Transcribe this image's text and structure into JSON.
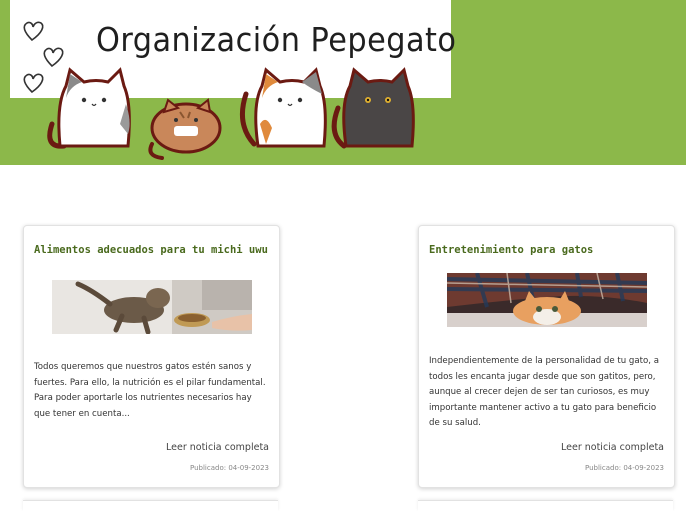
{
  "site": {
    "title": "Organización Pepegato"
  },
  "colors": {
    "banner": "#8cb84a",
    "card_title": "#4a6a1e"
  },
  "cards": [
    {
      "title": "Alimentos adecuados para tu michi uwu",
      "image": "cat-eating-photo",
      "text": "Todos queremos que nuestros gatos estén sanos y fuertes. Para ello, la nutrición es el pilar fundamental. Para poder aportarle los nutrientes necesarios hay que tener en cuenta...",
      "link": "Leer noticia completa",
      "date": "Publicado: 04-09-2023"
    },
    {
      "title": "Entretenimiento para gatos",
      "image": "kitten-under-blanket-photo",
      "text": "Independientemente de la personalidad de tu gato, a todos les encanta jugar desde que son gatitos, pero, aunque al crecer dejen de ser tan curiosos, es muy importante mantener activo a tu gato para beneficio de su salud.",
      "link": "Leer noticia completa",
      "date": "Publicado: 04-09-2023"
    }
  ]
}
